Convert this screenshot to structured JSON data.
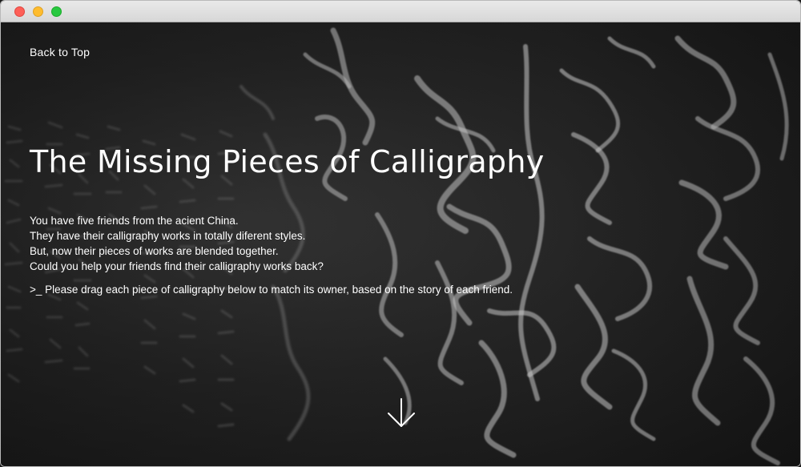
{
  "window": {
    "controls": [
      "close",
      "minimize",
      "maximize"
    ]
  },
  "nav": {
    "back_to_top": "Back to Top"
  },
  "hero": {
    "title": "The Missing Pieces of Calligraphy",
    "intro_lines": [
      "You have five friends from the acient China.",
      "They have their calligraphy works in totally diferent styles.",
      "But, now their pieces of works are blended together.",
      "Could you help your friends find their calligraphy works back?"
    ],
    "instruction": ">_ Please drag each piece of calligraphy below to match its owner, based on the story of each friend.",
    "scroll_icon": "arrow-down-icon"
  },
  "colors": {
    "text": "#ffffff",
    "background": "#262626",
    "chalk": "#d9d9d9",
    "close": "#fd5f57",
    "minimize": "#febc2e",
    "maximize": "#28c840"
  }
}
